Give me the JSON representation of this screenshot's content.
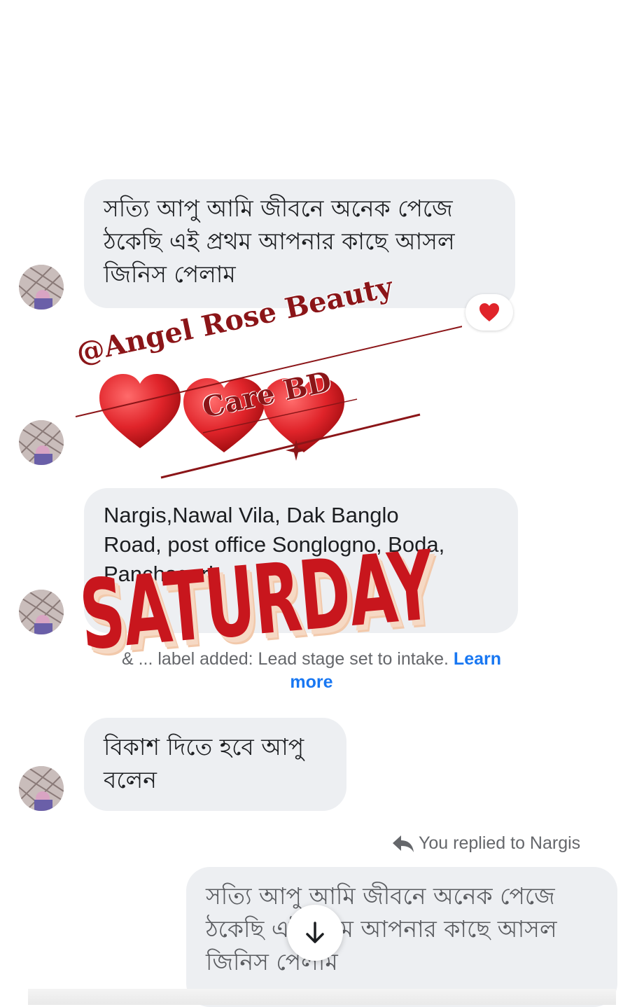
{
  "messages": {
    "msg1": "সত্যি আপু আমি জীবনে অনেক পেজে\nঠকেছি এই প্রথম আপনার কাছে আসল\nজিনিস পেলাম",
    "msg2": "Nargis,Nawal Vila, Dak Banglo\nRoad, post office Songlogno, Boda,\nPanchagarh",
    "msg3": "বিকাশ দিতে হবে আপু\nবলেন",
    "reply": "সত্যি আপু আমি জীবনে অনেক পেজে\nঠকেছি এই প্রথম আপনার কাছে আসল\nজিনিস পেলাম"
  },
  "system": {
    "text": "& ... label added: Lead stage set to intake.",
    "link_learn": "Learn",
    "link_more": "more"
  },
  "replied_label": "You replied to Nargis",
  "watermark": {
    "line1": "@Angel Rose Beauty",
    "line2": "Care BD",
    "sticker": "SATURDAY"
  },
  "icons": {
    "reaction": "heart-reaction-icon",
    "reply": "reply-arrow-icon",
    "scroll": "arrow-down-icon"
  },
  "colors": {
    "bubble": "#edeff2",
    "link": "#1877f2",
    "heart": "#e0242a",
    "watermark": "#8b1518",
    "sticker": "#c8161d"
  }
}
